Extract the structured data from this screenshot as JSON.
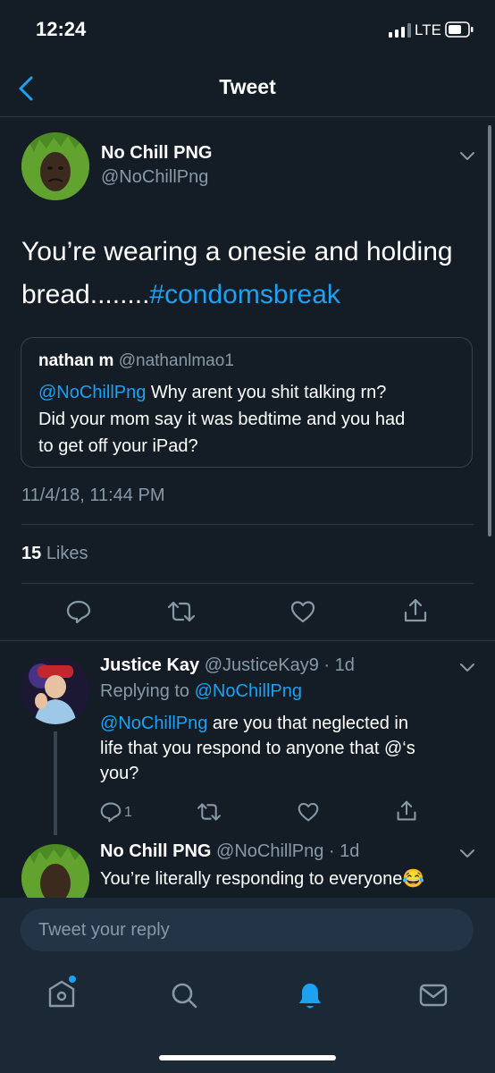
{
  "status_bar": {
    "time": "12:24",
    "network": "LTE"
  },
  "nav": {
    "title": "Tweet"
  },
  "tweet": {
    "author_name": "No Chill PNG",
    "author_handle": "@NoChillPng",
    "text_line1": "You’re wearing a onesie and holding",
    "text_line2_prefix": "bread........",
    "hashtag": "#condomsbreak",
    "timestamp": "11/4/18, 11:44 PM",
    "likes_count": "15",
    "likes_label": "Likes"
  },
  "quoted_tweet": {
    "author_name": "nathan m",
    "author_handle": "@nathanlmao1",
    "mention": "@NoChillPng",
    "line1_rest": " Why arent you shit talking rn?",
    "line2": "Did your mom say it was bedtime and you had",
    "line3": "to get off your iPad?"
  },
  "replies": [
    {
      "author_name": "Justice Kay",
      "meta": "@JusticeKay9 · 1d",
      "replying_prefix": "Replying to ",
      "replying_handle": "@NoChillPng",
      "mention": "@NoChillPng",
      "line1_rest": " are you that neglected in",
      "line2": "life that you respond to anyone that @‘s",
      "line3": "you?",
      "reply_count": "1"
    },
    {
      "author_name": "No Chill PNG",
      "meta": "@NoChillPng · 1d",
      "line1": "You’re literally responding to everyone",
      "emoji": "😂"
    }
  ],
  "composer": {
    "placeholder": "Tweet your reply"
  },
  "colors": {
    "background": "#141d26",
    "accent": "#1da1f2",
    "muted": "#8899a6",
    "divider": "#2a3845"
  },
  "icons": [
    "signal-icon",
    "battery-icon",
    "back-arrow-icon",
    "chevron-down-icon",
    "reply-icon",
    "retweet-icon",
    "like-icon",
    "share-icon",
    "home-icon",
    "search-icon",
    "notifications-icon",
    "messages-icon"
  ]
}
